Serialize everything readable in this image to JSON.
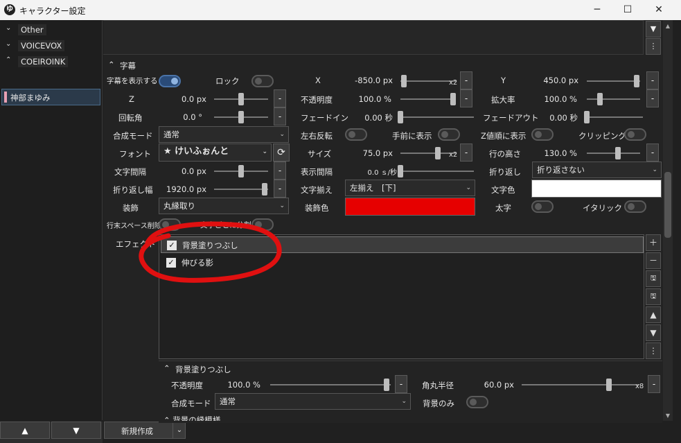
{
  "window": {
    "title": "キャラクター設定",
    "icon": "app-logo-icon",
    "controls": [
      "minimize-icon",
      "maximize-icon",
      "close-icon"
    ]
  },
  "sidebar": {
    "groups": [
      {
        "label": "Other",
        "icon": "chevron-down-icon"
      },
      {
        "label": "VOICEVOX",
        "icon": "chevron-down-icon"
      },
      {
        "label": "COEIROINK",
        "icon": "chevron-up-icon"
      }
    ],
    "selected_item": "神部まゆみ",
    "up_button": "▲",
    "down_button": "▼"
  },
  "new_button": {
    "label": "新規作成",
    "dropdown": "⌄"
  },
  "section": {
    "title": "字幕",
    "collapse_icon": "chevron-up-icon"
  },
  "fields": {
    "show_subtitle": {
      "label": "字幕を表示する",
      "on": true
    },
    "lock": {
      "label": "ロック",
      "on": false
    },
    "x": {
      "label": "X",
      "value": "-850.0 px",
      "mult": "x2",
      "fraction": 0.01
    },
    "y": {
      "label": "Y",
      "value": "450.0 px",
      "fraction": 0.99
    },
    "z": {
      "label": "Z",
      "value": "0.0 px",
      "fraction": 0.5
    },
    "opacity": {
      "label": "不透明度",
      "value": "100.0 %",
      "fraction": 1
    },
    "scale": {
      "label": "拡大率",
      "value": "100.0 %",
      "fraction": 0.22
    },
    "rotation": {
      "label": "回転角",
      "value": "0.0 °",
      "fraction": 0.5
    },
    "fade_in": {
      "label": "フェードイン",
      "value": "0.00 秒",
      "fraction": 0
    },
    "fade_out": {
      "label": "フェードアウト",
      "value": "0.00 秒",
      "fraction": 0
    },
    "blend_mode": {
      "label": "合成モード",
      "value": "通常"
    },
    "flip_h": {
      "label": "左右反転",
      "on": false
    },
    "front": {
      "label": "手前に表示",
      "on": false
    },
    "z_order": {
      "label": "Z値順に表示",
      "on": false
    },
    "clipping": {
      "label": "クリッピング",
      "on": false
    },
    "font": {
      "label": "フォント",
      "value": "★ けいふぉんと",
      "reload_icon": "refresh-icon"
    },
    "size": {
      "label": "サイズ",
      "value": "75.0 px",
      "mult": "x2",
      "fraction": 0.7
    },
    "line_height": {
      "label": "行の高さ",
      "value": "130.0 %",
      "fraction": 0.6
    },
    "char_spacing": {
      "label": "文字間隔",
      "value": "0.0 px",
      "fraction": 0.5
    },
    "display_interval": {
      "label": "表示間隔",
      "value": "0.0 ｓ/秒",
      "fraction": 0
    },
    "wrap": {
      "label": "折り返し",
      "value": "折り返さない"
    },
    "wrap_width": {
      "label": "折り返し幅",
      "value": "1920.0 px",
      "fraction": 0.98
    },
    "align": {
      "label": "文字揃え",
      "value": "左揃え　[下]"
    },
    "text_color": {
      "label": "文字色",
      "color": "#ffffff"
    },
    "decoration": {
      "label": "装飾",
      "value": "丸縁取り"
    },
    "decoration_color": {
      "label": "装飾色",
      "color": "#e60000"
    },
    "bold": {
      "label": "太字",
      "on": false
    },
    "italic": {
      "label": "イタリック",
      "on": false
    },
    "trim_trailing": {
      "label": "行末スペース削除",
      "on": false
    },
    "split_chars": {
      "label": "文字ごとに分割",
      "on": false
    },
    "minus": "-"
  },
  "effects": {
    "label": "エフェクト",
    "items": [
      {
        "label": "背景塗りつぶし",
        "checked": true,
        "selected": true
      },
      {
        "label": "伸びる影",
        "checked": true,
        "selected": false
      }
    ],
    "side_buttons": [
      "plus-icon",
      "minus-icon",
      "save-as-icon",
      "save-icon",
      "move-up-icon",
      "move-down-icon",
      "more-icon"
    ]
  },
  "sub_section": {
    "title": "背景塗りつぶし",
    "opacity": {
      "label": "不透明度",
      "value": "100.0 %",
      "fraction": 0.99
    },
    "radius": {
      "label": "角丸半径",
      "value": "60.0 px",
      "mult": "x8",
      "fraction": 0.75
    },
    "blend": {
      "label": "合成モード",
      "value": "通常"
    },
    "bg_only": {
      "label": "背景のみ",
      "on": false
    },
    "next_title": "背景の縁模様"
  },
  "annotation": {
    "color": "#e01010"
  }
}
